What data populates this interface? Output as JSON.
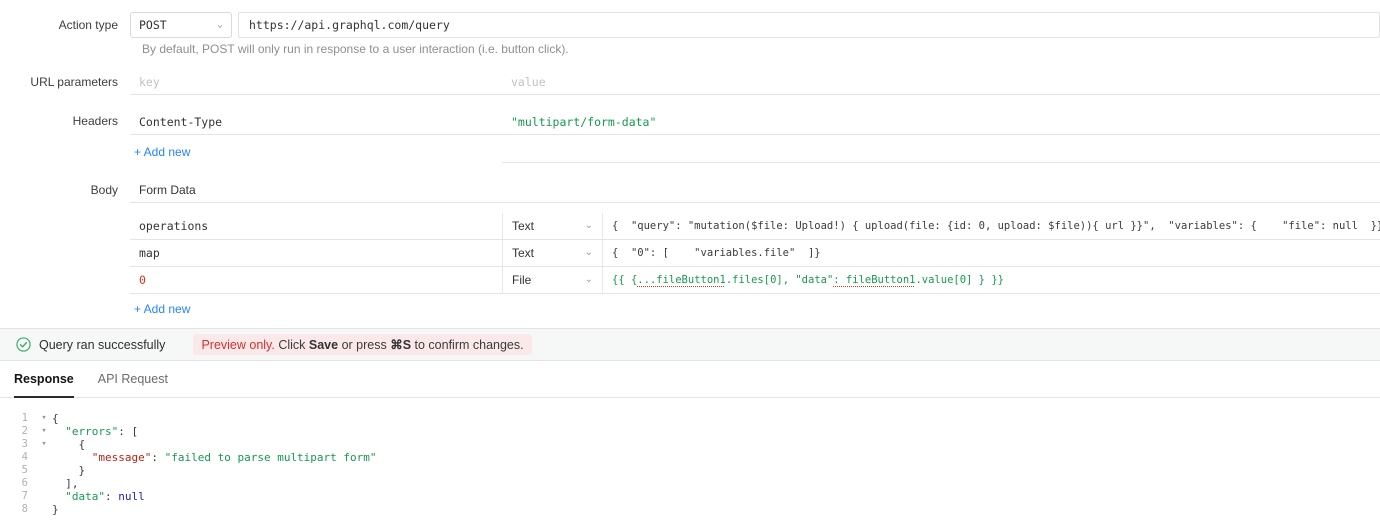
{
  "icons": {
    "chevron_down": "⌄"
  },
  "form": {
    "action_type": {
      "label": "Action type",
      "method": "POST",
      "url": "https://api.graphql.com/query",
      "helper": "By default, POST will only run in response to a user interaction (i.e. button click)."
    },
    "url_params": {
      "label": "URL parameters",
      "key_placeholder": "key",
      "value_placeholder": "value"
    },
    "headers": {
      "label": "Headers",
      "rows": [
        {
          "key": "Content-Type",
          "value": "\"multipart/form-data\""
        }
      ],
      "add_new": "+ Add new"
    },
    "body": {
      "label": "Body",
      "type": "Form Data",
      "rows": [
        {
          "key": "operations",
          "type": "Text",
          "value_tokens": [
            {
              "x": "{  \"query\": \"mutation($file: Upload!) { upload(file: {id: 0, upload: $file)){ url }}\",  \"variables\": {    \"file\": null  }}",
              "c": "plain"
            }
          ]
        },
        {
          "key": "map",
          "type": "Text",
          "value_tokens": [
            {
              "x": "{  \"0\": [    \"variables.file\"  ]}",
              "c": "plain"
            }
          ]
        },
        {
          "key": "0",
          "type": "File",
          "value_tokens": [
            {
              "x": "{{ {",
              "c": "expr"
            },
            {
              "x": "...fileButton1",
              "c": "expr-u"
            },
            {
              "x": ".files[0], \"data\"",
              "c": "expr"
            },
            {
              "x": ": fileButton1",
              "c": "expr-u"
            },
            {
              "x": ".value[0] } }}",
              "c": "expr"
            }
          ]
        }
      ],
      "add_new": "+ Add new"
    }
  },
  "status_bar": {
    "success": "Query ran successfully",
    "preview_tokens": [
      {
        "x": "Preview only.",
        "c": "warn"
      },
      {
        "x": " Click ",
        "c": "plain"
      },
      {
        "x": "Save",
        "c": "bold"
      },
      {
        "x": " or press ",
        "c": "plain"
      },
      {
        "x": "⌘S",
        "c": "bold"
      },
      {
        "x": " to confirm changes.",
        "c": "plain"
      }
    ]
  },
  "tabs": {
    "response": "Response",
    "api_request": "API Request"
  },
  "code": {
    "lines": [
      {
        "num": "1",
        "fold": "▾",
        "tokens": [
          {
            "x": "{",
            "c": "plain"
          }
        ]
      },
      {
        "num": "2",
        "fold": "▾",
        "tokens": [
          {
            "x": "  ",
            "c": "plain"
          },
          {
            "x": "\"errors\"",
            "c": "key"
          },
          {
            "x": ": [",
            "c": "plain"
          }
        ]
      },
      {
        "num": "3",
        "fold": "▾",
        "tokens": [
          {
            "x": "    {",
            "c": "plain"
          }
        ]
      },
      {
        "num": "4",
        "tokens": [
          {
            "x": "      ",
            "c": "plain"
          },
          {
            "x": "\"message\"",
            "c": "keyr"
          },
          {
            "x": ": ",
            "c": "plain"
          },
          {
            "x": "\"failed to parse multipart form\"",
            "c": "str"
          }
        ]
      },
      {
        "num": "5",
        "tokens": [
          {
            "x": "    }",
            "c": "plain"
          }
        ]
      },
      {
        "num": "6",
        "tokens": [
          {
            "x": "  ],",
            "c": "plain"
          }
        ]
      },
      {
        "num": "7",
        "tokens": [
          {
            "x": "  ",
            "c": "plain"
          },
          {
            "x": "\"data\"",
            "c": "key"
          },
          {
            "x": ": ",
            "c": "plain"
          },
          {
            "x": "null",
            "c": "null"
          }
        ]
      },
      {
        "num": "8",
        "tokens": [
          {
            "x": "}",
            "c": "plain"
          }
        ]
      }
    ]
  }
}
